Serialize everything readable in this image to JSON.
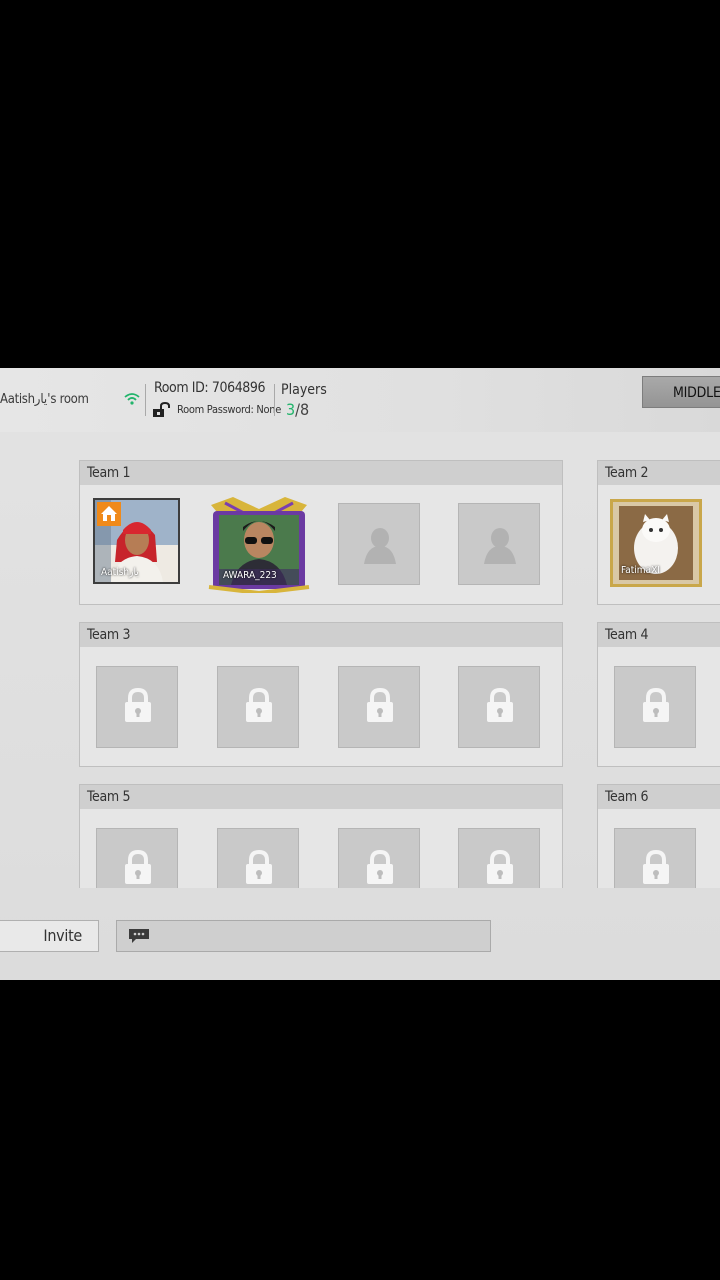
{
  "room": {
    "name": "Aatishیار's room",
    "room_id": "Room ID: 7064896",
    "password": "Room Password: None",
    "players_label": "Players",
    "players_current": "3",
    "players_max": "/8",
    "mode_button": "MIDDLE E"
  },
  "teams": [
    {
      "label": "Team 1"
    },
    {
      "label": "Team 2"
    },
    {
      "label": "Team 3"
    },
    {
      "label": "Team 4"
    },
    {
      "label": "Team 5"
    },
    {
      "label": "Team 6"
    }
  ],
  "players": [
    {
      "name": "Aatishیار",
      "host": true
    },
    {
      "name": "AWARA_223",
      "host": false
    },
    {
      "name": "FatimaXI",
      "host": false
    }
  ],
  "bottom": {
    "invite_label": "Invite Friend"
  },
  "colors": {
    "accent_green": "#22b46b",
    "host_badge": "#f08a1a"
  },
  "icons": [
    "wifi-icon",
    "unlocked-icon",
    "home-icon",
    "person-placeholder-icon",
    "lock-icon",
    "chat-icon"
  ]
}
